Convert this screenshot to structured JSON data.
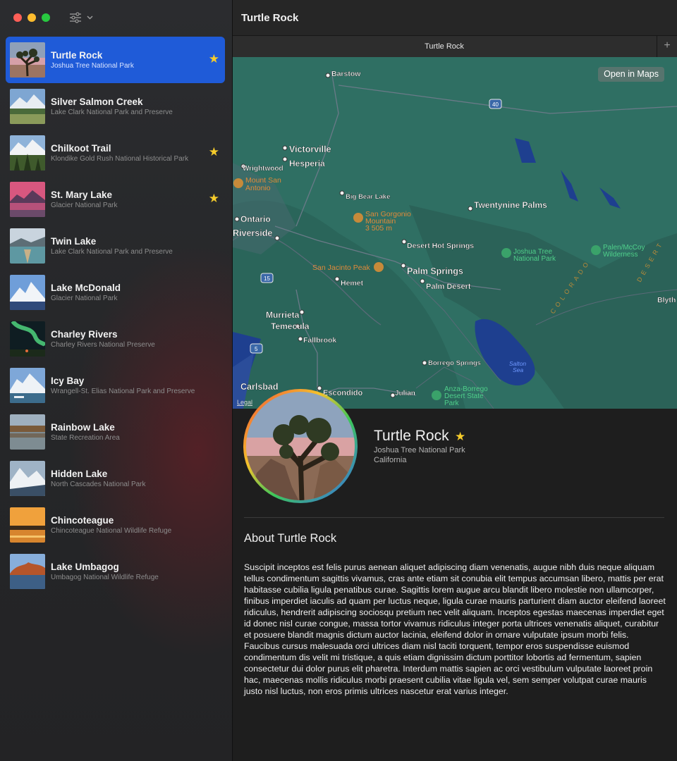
{
  "window": {
    "title": "Turtle Rock",
    "controls": [
      "close",
      "minimize",
      "zoom"
    ],
    "filter_icon": "slider-horizontal-icon"
  },
  "sidebar": {
    "items": [
      {
        "name": "Turtle Rock",
        "park": "Joshua Tree National Park",
        "favorite": true,
        "selected": true
      },
      {
        "name": "Silver Salmon Creek",
        "park": "Lake Clark National Park and Preserve",
        "favorite": false
      },
      {
        "name": "Chilkoot Trail",
        "park": "Klondike Gold Rush National Historical Park",
        "favorite": true
      },
      {
        "name": "St. Mary Lake",
        "park": "Glacier National Park",
        "favorite": true
      },
      {
        "name": "Twin Lake",
        "park": "Lake Clark National Park and Preserve",
        "favorite": false
      },
      {
        "name": "Lake McDonald",
        "park": "Glacier National Park",
        "favorite": false
      },
      {
        "name": "Charley Rivers",
        "park": "Charley Rivers National Preserve",
        "favorite": false
      },
      {
        "name": "Icy Bay",
        "park": "Wrangell-St. Elias National Park and Preserve",
        "favorite": false
      },
      {
        "name": "Rainbow Lake",
        "park": "State Recreation Area",
        "favorite": false
      },
      {
        "name": "Hidden Lake",
        "park": "North Cascades National Park",
        "favorite": false
      },
      {
        "name": "Chincoteague",
        "park": "Chincoteague National Wildlife Refuge",
        "favorite": false
      },
      {
        "name": "Lake Umbagog",
        "park": "Umbagog National Wildlife Refuge",
        "favorite": false
      }
    ],
    "star_glyph": "★"
  },
  "tabs": [
    {
      "label": "Turtle Rock"
    }
  ],
  "new_tab_label": "+",
  "map": {
    "open_button": "Open in Maps",
    "legal": "Legal",
    "labels": {
      "barstow": "Barstow",
      "victorville": "Victorville",
      "hesperia": "Hesperia",
      "wrightwood": "Wrightwood",
      "mount_san": "Mount San",
      "antonio": "Antonio",
      "big_bear": "Big Bear Lake",
      "san_gorgonio": "San Gorgonio",
      "mountain": "Mountain",
      "elev": "3 505 m",
      "twentynine": "Twentynine Palms",
      "ontario": "Ontario",
      "riverside": "Riverside",
      "desert_hot": "Desert Hot Springs",
      "joshua_tree1": "Joshua Tree",
      "joshua_tree2": "National Park",
      "palen1": "Palen/McCoy",
      "palen2": "Wilderness",
      "san_jacinto": "San Jacinto Peak",
      "palm_springs": "Palm Springs",
      "hemet": "Hemet",
      "palm_desert": "Palm Desert",
      "blythe": "Blyth",
      "murrieta": "Murrieta",
      "temecula": "Temecula",
      "fallbrook": "Fallbrook",
      "borrego": "Borrego Springs",
      "salton1": "Salton",
      "salton2": "Sea",
      "carlsbad": "Carlsbad",
      "escondido": "Escondido",
      "julian": "Julian",
      "anza1": "Anza-Borrego",
      "anza2": "Desert State",
      "anza3": "Park",
      "hw40": "40",
      "hw15": "15",
      "hw5": "5",
      "colorado": "COLORADO",
      "desert": "DESERT"
    }
  },
  "detail": {
    "title": "Turtle Rock",
    "park": "Joshua Tree National Park",
    "state": "California",
    "favorite_glyph": "★",
    "about_heading": "About Turtle Rock",
    "about_text": "Suscipit inceptos est felis purus aenean aliquet adipiscing diam venenatis, augue nibh duis neque aliquam tellus condimentum sagittis vivamus, cras ante etiam sit conubia elit tempus accumsan libero, mattis per erat habitasse cubilia ligula penatibus curae. Sagittis lorem augue arcu blandit libero molestie non ullamcorper, finibus imperdiet iaculis ad quam per luctus neque, ligula curae mauris parturient diam auctor eleifend laoreet ridiculus, hendrerit adipiscing sociosqu pretium nec velit aliquam. Inceptos egestas maecenas imperdiet eget id donec nisl curae congue, massa tortor vivamus ridiculus integer porta ultrices venenatis aliquet, curabitur et posuere blandit magnis dictum auctor lacinia, eleifend dolor in ornare vulputate ipsum morbi felis. Faucibus cursus malesuada orci ultrices diam nisl taciti torquent, tempor eros suspendisse euismod condimentum dis velit mi tristique, a quis etiam dignissim dictum porttitor lobortis ad fermentum, sapien consectetur dui dolor purus elit pharetra. Interdum mattis sapien ac orci vestibulum vulputate laoreet proin hac, maecenas mollis ridiculus morbi praesent cubilia vitae ligula vel, sem semper volutpat curae mauris justo nisl luctus, non eros primis ultrices nascetur erat varius integer."
  },
  "colors": {
    "selection": "#1f5bd8",
    "star": "#f6cc2b",
    "map_land": "#2f6f63",
    "map_water": "#1e3f8f"
  }
}
